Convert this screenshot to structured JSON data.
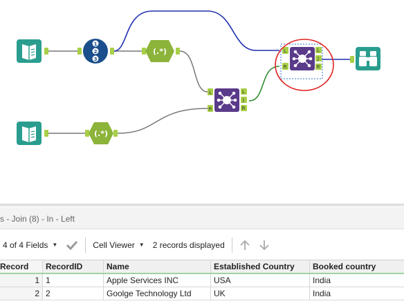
{
  "workflow": {
    "tools": [
      {
        "id": "input-1",
        "type": "Input Data"
      },
      {
        "id": "input-2",
        "type": "Input Data"
      },
      {
        "id": "record-id",
        "type": "Record ID",
        "digits": [
          "1",
          "2",
          "3"
        ]
      },
      {
        "id": "formula-1",
        "type": "Formula",
        "glyph": "(.*)"
      },
      {
        "id": "formula-2",
        "type": "Formula",
        "glyph": "(.*)"
      },
      {
        "id": "join-1",
        "type": "Join",
        "anchors_in": [
          "L",
          "R"
        ],
        "anchors_out": [
          "L",
          "J",
          "R"
        ]
      },
      {
        "id": "join-2",
        "type": "Join",
        "anchors_in": [
          "L",
          "R"
        ],
        "anchors_out": [
          "L",
          "J",
          "R"
        ],
        "selected": true,
        "annotated": true
      },
      {
        "id": "browse",
        "type": "Browse"
      }
    ],
    "colors": {
      "input": "#2a9d8f",
      "record_id": "#1a4e8c",
      "formula": "#8cb33a",
      "join": "#5a3a8a",
      "browse": "#2a9d8f",
      "wire_blue": "#1f2fb0",
      "wire_green": "#2e8b2e",
      "wire_gray": "#777777",
      "annotation_circle": "#e02020",
      "anchor": "#a8cf47"
    }
  },
  "results": {
    "title": "s - Join (8) - In - Left",
    "toolbar": {
      "fields": "4 of 4 Fields",
      "cell_viewer": "Cell Viewer",
      "records_displayed": "2 records displayed"
    },
    "columns": [
      "Record",
      "RecordID",
      "Name",
      "Established Country",
      "Booked country"
    ],
    "rows": [
      [
        "1",
        "1",
        "Apple Services INC",
        "USA",
        "India"
      ],
      [
        "2",
        "2",
        "Goolge Technology Ltd",
        "UK",
        "India"
      ]
    ]
  }
}
